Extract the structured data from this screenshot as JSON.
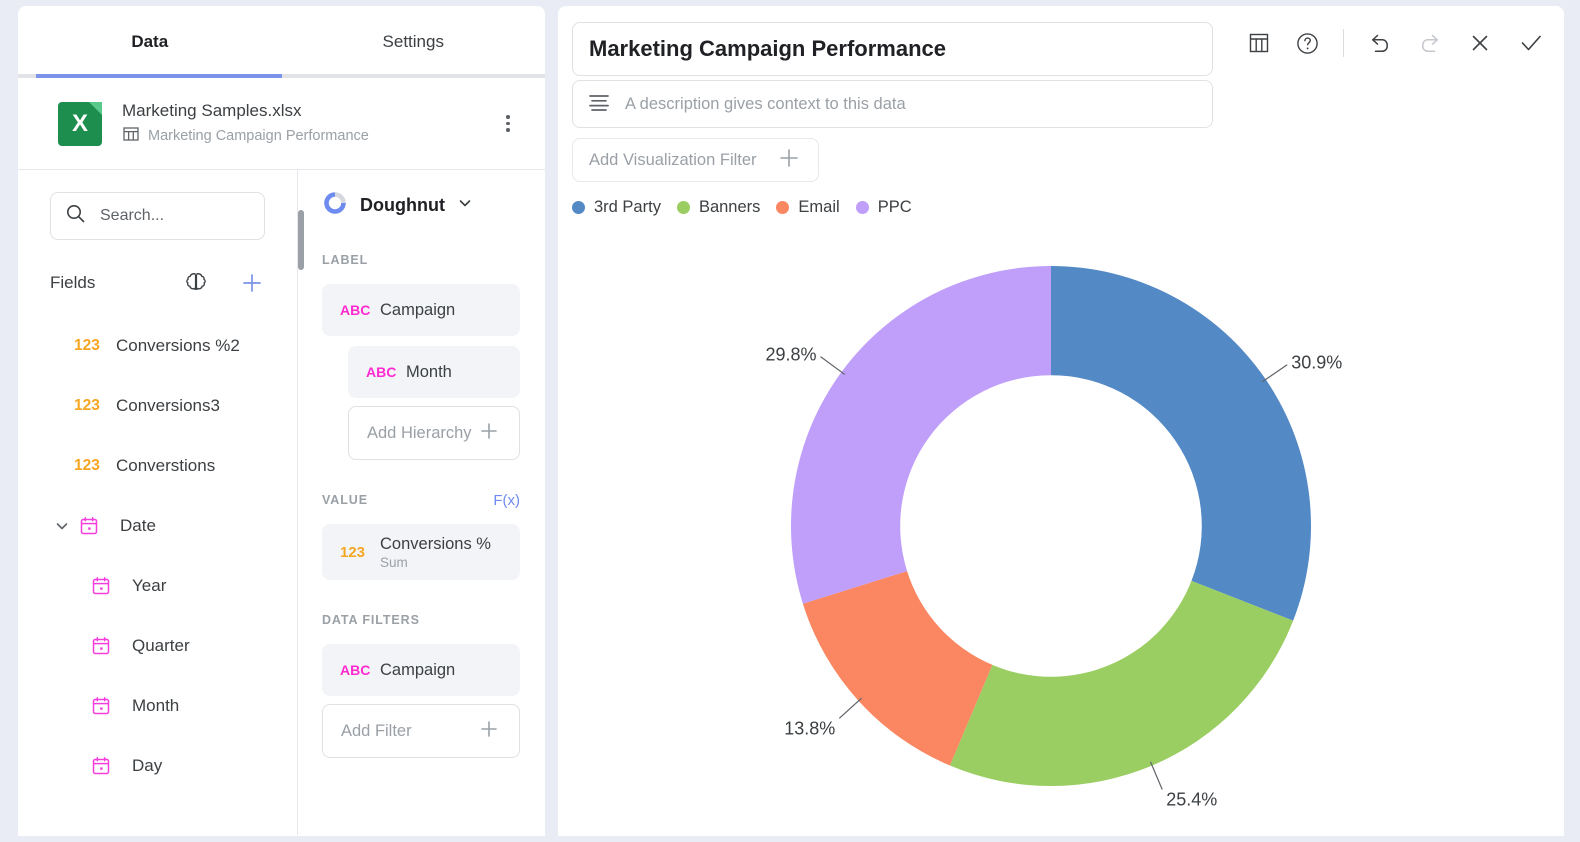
{
  "tabs": [
    {
      "label": "Data",
      "active": true
    },
    {
      "label": "Settings",
      "active": false
    }
  ],
  "file": {
    "name": "Marketing Samples.xlsx",
    "sheet": "Marketing Campaign Performance",
    "icon": "excel-file-icon",
    "sheet_icon": "table-icon",
    "menu_icon": "kebab-menu-icon"
  },
  "search": {
    "placeholder": "Search...",
    "value": "",
    "icon": "search-icon"
  },
  "fields_panel": {
    "title": "Fields",
    "ai_icon": "brain-icon",
    "add_icon": "plus-icon",
    "items": [
      {
        "label": "Conversions %2",
        "type": "123",
        "level": 0,
        "expandable": false
      },
      {
        "label": "Conversions3",
        "type": "123",
        "level": 0,
        "expandable": false
      },
      {
        "label": "Converstions",
        "type": "123",
        "level": 0,
        "expandable": false
      },
      {
        "label": "Date",
        "type": "date",
        "level": 0,
        "expandable": true,
        "expanded": true
      },
      {
        "label": "Year",
        "type": "date",
        "level": 1,
        "expandable": false
      },
      {
        "label": "Quarter",
        "type": "date",
        "level": 1,
        "expandable": false
      },
      {
        "label": "Month",
        "type": "date",
        "level": 1,
        "expandable": false
      },
      {
        "label": "Day",
        "type": "date",
        "level": 1,
        "expandable": false
      }
    ]
  },
  "chart_type": {
    "label": "Doughnut",
    "icon": "doughnut-chart-icon",
    "caret": "chevron-down-icon"
  },
  "wells": {
    "label": {
      "header": "LABEL",
      "chips": [
        {
          "label": "Campaign",
          "type": "ABC",
          "indent": false
        },
        {
          "label": "Month",
          "type": "ABC",
          "indent": true
        }
      ],
      "add_label": "Add Hierarchy",
      "add_icon": "plus-icon"
    },
    "value": {
      "header": "VALUE",
      "fx_label": "F(x)",
      "chips": [
        {
          "label": "Conversions %",
          "sub": "Sum",
          "type": "123",
          "indent": false
        }
      ]
    },
    "data_filters": {
      "header": "DATA FILTERS",
      "chips": [
        {
          "label": "Campaign",
          "type": "ABC",
          "indent": false
        }
      ],
      "add_label": "Add Filter",
      "add_icon": "plus-icon"
    }
  },
  "header": {
    "title": "Marketing Campaign Performance",
    "description_placeholder": "A description gives context to this data",
    "description_icon": "description-lines-icon",
    "viz_filter_label": "Add Visualization Filter",
    "viz_filter_icon": "plus-icon"
  },
  "toolbar": [
    {
      "name": "table-view-icon",
      "title": "Table"
    },
    {
      "name": "help-icon",
      "title": "Help"
    },
    {
      "name": "separator",
      "title": ""
    },
    {
      "name": "undo-icon",
      "title": "Undo"
    },
    {
      "name": "redo-icon",
      "title": "Redo"
    },
    {
      "name": "close-icon",
      "title": "Close"
    },
    {
      "name": "confirm-check-icon",
      "title": "Apply"
    }
  ],
  "colors": {
    "blue": "#5389c5",
    "green": "#9bce62",
    "orange": "#fa8761",
    "purple": "#c09ffa",
    "accent": "#7b93e8",
    "number_field": "#f5a623",
    "text_field": "#ff2bd1"
  },
  "chart_data": {
    "type": "pie",
    "variant": "doughnut",
    "title": "Marketing Campaign Performance",
    "value_field": "Conversions % (Sum)",
    "label_field": "Campaign",
    "categories": [
      "3rd Party",
      "Banners",
      "Email",
      "PPC"
    ],
    "values": [
      30.9,
      25.4,
      13.8,
      29.8
    ],
    "data_labels": [
      "30.9%",
      "25.4%",
      "13.8%",
      "29.8%"
    ],
    "colors": [
      "#5389c5",
      "#9bce62",
      "#fa8761",
      "#c09ffa"
    ],
    "legend_position": "top-left",
    "inner_radius_ratio": 0.58,
    "start_angle": 0,
    "xlabel": "",
    "ylabel": ""
  }
}
